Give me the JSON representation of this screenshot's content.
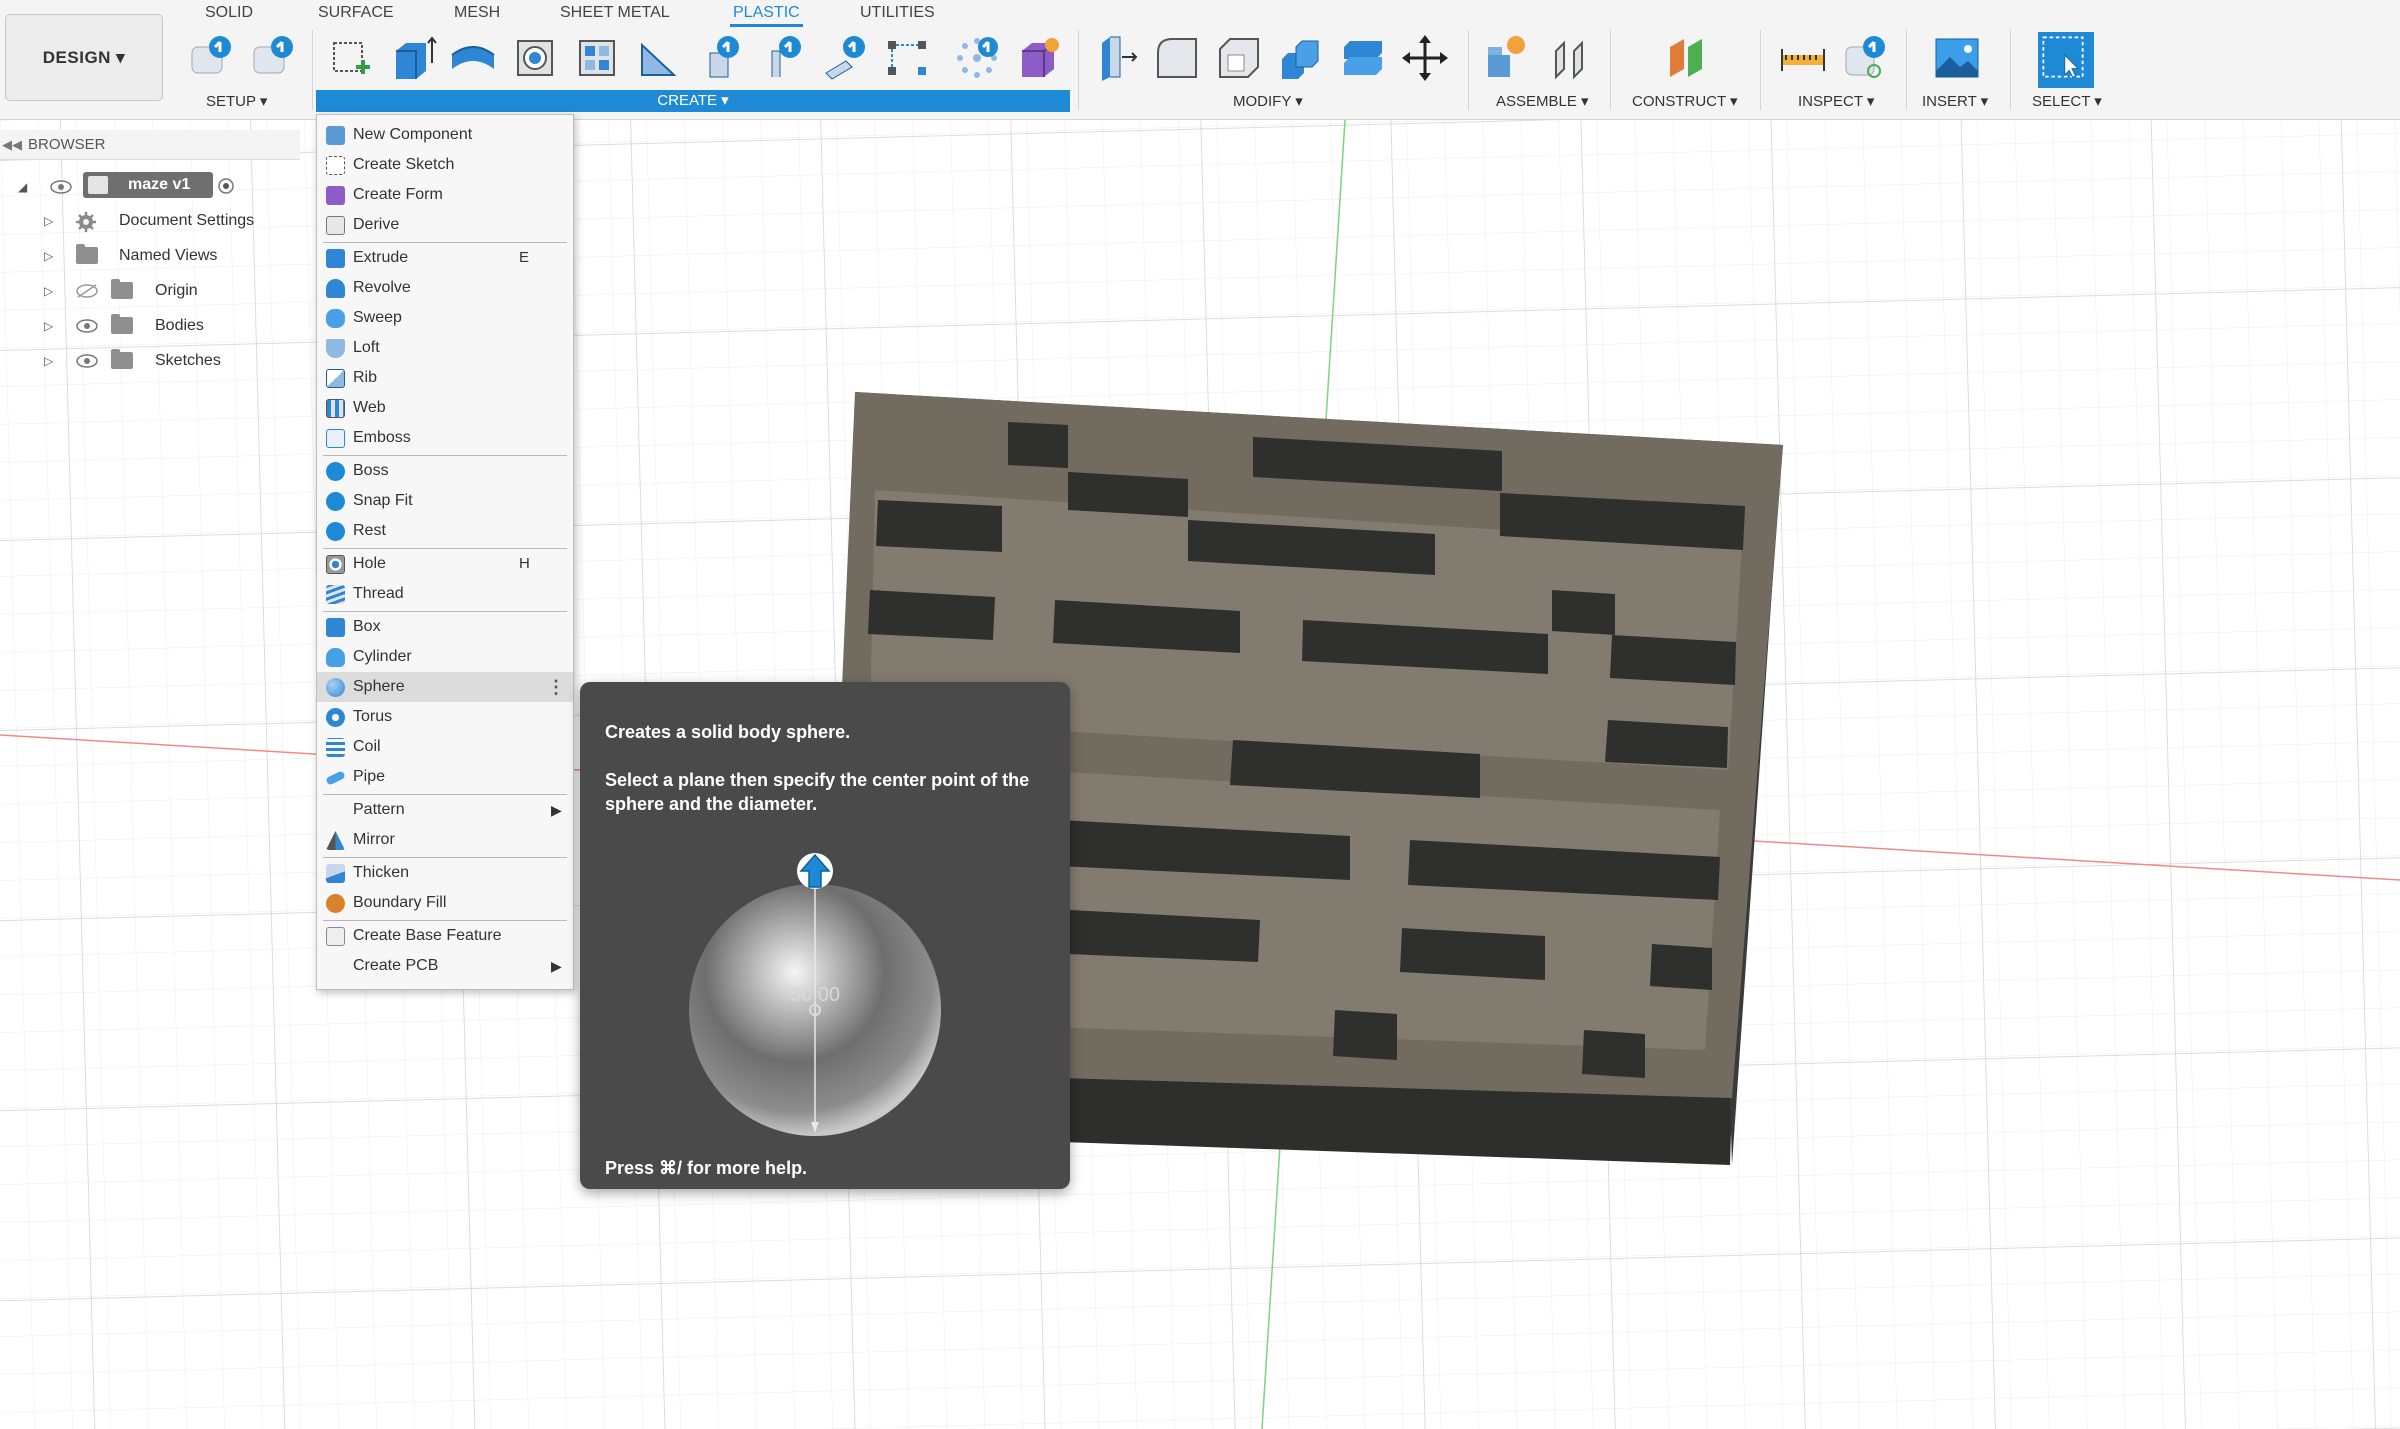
{
  "workspace": "DESIGN",
  "tabs": [
    "SOLID",
    "SURFACE",
    "MESH",
    "SHEET METAL",
    "PLASTIC",
    "UTILITIES"
  ],
  "active_tab": "PLASTIC",
  "toolbar_groups": {
    "setup": "SETUP",
    "create": "CREATE",
    "modify": "MODIFY",
    "assemble": "ASSEMBLE",
    "construct": "CONSTRUCT",
    "inspect": "INSPECT",
    "insert": "INSERT",
    "select": "SELECT"
  },
  "browser": {
    "title": "BROWSER",
    "root": "maze v1",
    "items": [
      {
        "label": "Document Settings",
        "icon": "gear-icon"
      },
      {
        "label": "Named Views",
        "icon": "folder-icon"
      },
      {
        "label": "Origin",
        "icon": "folder-icon",
        "hidden": true
      },
      {
        "label": "Bodies",
        "icon": "folder-icon"
      },
      {
        "label": "Sketches",
        "icon": "folder-icon"
      }
    ]
  },
  "create_menu": {
    "items": [
      {
        "label": "New Component",
        "icon": "new-component-icon",
        "color": "#5b9bd5"
      },
      {
        "label": "Create Sketch",
        "icon": "sketch-icon",
        "color": "#2e9e4a"
      },
      {
        "label": "Create Form",
        "icon": "form-icon",
        "color": "#8e5cc7"
      },
      {
        "label": "Derive",
        "icon": "derive-icon",
        "color": "#7a7a7a"
      },
      {
        "label": "Extrude",
        "icon": "extrude-icon",
        "shortcut": "E",
        "color": "#2f86d4"
      },
      {
        "label": "Revolve",
        "icon": "revolve-icon",
        "color": "#2f86d4"
      },
      {
        "label": "Sweep",
        "icon": "sweep-icon",
        "color": "#2f86d4"
      },
      {
        "label": "Loft",
        "icon": "loft-icon",
        "color": "#2f86d4"
      },
      {
        "label": "Rib",
        "icon": "rib-icon",
        "color": "#2f86d4"
      },
      {
        "label": "Web",
        "icon": "web-icon",
        "color": "#2f86d4"
      },
      {
        "label": "Emboss",
        "icon": "emboss-icon",
        "color": "#2f86d4"
      },
      {
        "label": "Boss",
        "icon": "boss-icon",
        "color": "#1e8ad6"
      },
      {
        "label": "Snap Fit",
        "icon": "snap-fit-icon",
        "color": "#1e8ad6"
      },
      {
        "label": "Rest",
        "icon": "rest-icon",
        "color": "#1e8ad6"
      },
      {
        "label": "Hole",
        "icon": "hole-icon",
        "shortcut": "H",
        "color": "#6f6f6f"
      },
      {
        "label": "Thread",
        "icon": "thread-icon",
        "color": "#2f86d4"
      },
      {
        "label": "Box",
        "icon": "box-icon",
        "color": "#2f86d4"
      },
      {
        "label": "Cylinder",
        "icon": "cylinder-icon",
        "color": "#2f86d4"
      },
      {
        "label": "Sphere",
        "icon": "sphere-icon",
        "color": "#2f86d4",
        "highlighted": true
      },
      {
        "label": "Torus",
        "icon": "torus-icon",
        "color": "#2f86d4"
      },
      {
        "label": "Coil",
        "icon": "coil-icon",
        "color": "#2f86d4"
      },
      {
        "label": "Pipe",
        "icon": "pipe-icon",
        "color": "#2f86d4"
      },
      {
        "label": "Pattern",
        "icon": "",
        "submenu": true
      },
      {
        "label": "Mirror",
        "icon": "mirror-icon",
        "color": "#2f86d4"
      },
      {
        "label": "Thicken",
        "icon": "thicken-icon",
        "color": "#2f86d4"
      },
      {
        "label": "Boundary Fill",
        "icon": "boundary-fill-icon",
        "color": "#d9822b"
      },
      {
        "label": "Create Base Feature",
        "icon": "base-feature-icon",
        "color": "#9a9a9a"
      },
      {
        "label": "Create PCB",
        "icon": "",
        "submenu": true
      }
    ]
  },
  "tooltip": {
    "title": "Creates a solid body sphere.",
    "description": "Select a plane then specify the center point of the sphere and the diameter.",
    "diameter_value": "50.00",
    "help": "Press ⌘/ for more help."
  },
  "colors": {
    "accent": "#1e8ad6",
    "menu_bg": "#f7f7f7",
    "tooltip_bg": "#4a4a4a",
    "model_face": "#716b60",
    "model_dark": "#3a3a38"
  }
}
